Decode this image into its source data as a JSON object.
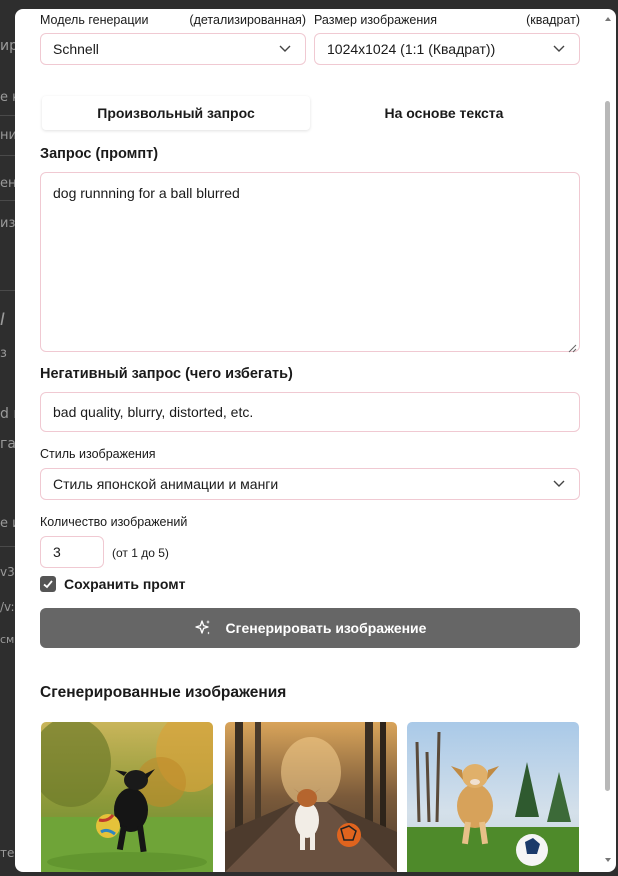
{
  "background_fragments": [
    "е",
    "ир",
    "е к",
    "ни",
    "ент",
    "из",
    "I",
    "з",
    "d п",
    "гае",
    "е и",
    "v3.",
    "/v:",
    "смо",
    "те."
  ],
  "form": {
    "model": {
      "label": "Модель генерации",
      "hint": "(детализированная)",
      "value": "Schnell"
    },
    "size": {
      "label": "Размер изображения",
      "hint": "(квадрат)",
      "value": "1024x1024 (1:1 (Квадрат))"
    },
    "tabs": [
      {
        "label": "Произвольный запрос",
        "active": true
      },
      {
        "label": "На основе текста",
        "active": false
      }
    ],
    "prompt": {
      "label": "Запрос (промпт)",
      "value": "dog runnning for a ball blurred"
    },
    "negative": {
      "label": "Негативный запрос (чего избегать)",
      "placeholder": "bad quality, blurry, distorted, etc."
    },
    "style": {
      "label": "Стиль изображения",
      "value": "Стиль японской анимации и манги"
    },
    "count": {
      "label": "Количество изображений",
      "value": "3",
      "hint": "(от 1 до 5)"
    },
    "save_prompt": {
      "label": "Сохранить промт",
      "checked": true
    },
    "generate_label": "Сгенерировать изображение"
  },
  "results": {
    "title": "Сгенерированные изображения",
    "images": [
      {
        "subject": "black dog running with soccer ball in autumn park"
      },
      {
        "subject": "terrier running toward orange ball on forest path"
      },
      {
        "subject": "golden dog running toward soccer ball on lawn"
      }
    ]
  },
  "colors": {
    "field_border": "#f0c9d2",
    "button_bg": "#666666",
    "checkbox_bg": "#555555"
  }
}
